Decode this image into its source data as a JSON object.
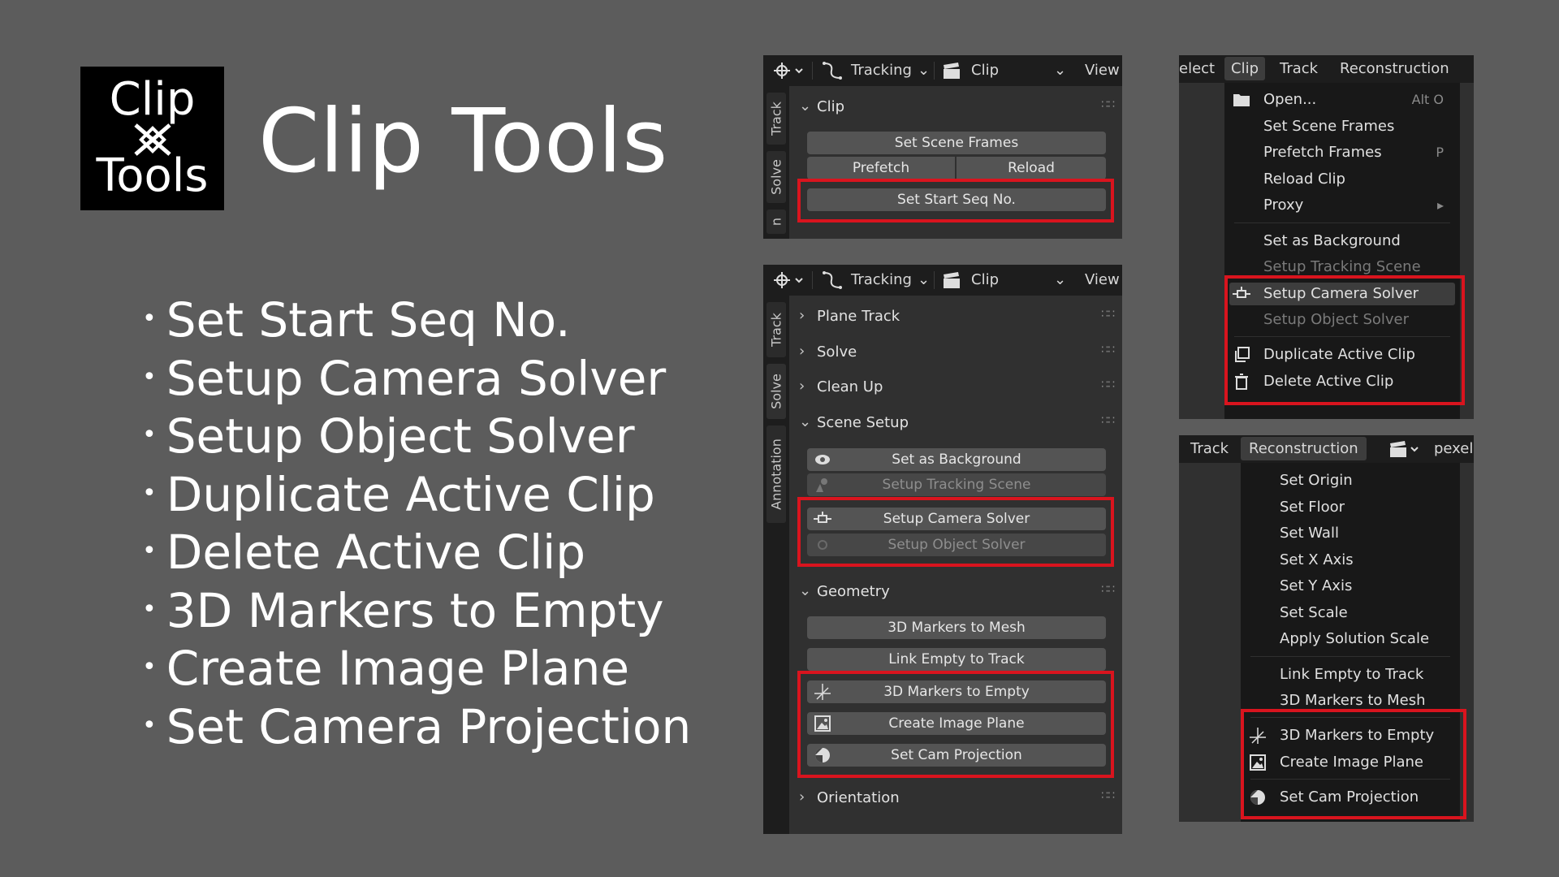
{
  "logo": {
    "line1": "Clip",
    "line2": "Tools"
  },
  "title": "Clip Tools",
  "features": [
    "Set Start Seq No.",
    "Setup Camera Solver",
    "Setup Object Solver",
    "Duplicate Active Clip",
    "Delete Active Clip",
    "3D Markers to Empty",
    "Create Image Plane",
    "Set Camera Projection"
  ],
  "header": {
    "mode": "Tracking",
    "clip": "Clip",
    "view": "View"
  },
  "panel1": {
    "tabs": [
      "Track",
      "Solve",
      "n"
    ],
    "section": "Clip",
    "buttons": [
      "Set Scene Frames",
      "Prefetch",
      "Reload",
      "Set Start Seq No."
    ]
  },
  "panel2": {
    "tabs": [
      "Track",
      "Solve",
      "Annotation"
    ],
    "sections": [
      "Plane Track",
      "Solve",
      "Clean Up",
      "Scene Setup",
      "Geometry",
      "Orientation"
    ],
    "scene_setup": [
      "Set as Background",
      "Setup Tracking Scene",
      "Setup Camera Solver",
      "Setup Object Solver"
    ],
    "geometry": [
      "3D Markers to Mesh",
      "Link Empty to Track",
      "3D Markers to Empty",
      "Create Image Plane",
      "Set Cam Projection"
    ]
  },
  "menu1": {
    "header": [
      "elect",
      "Clip",
      "Track",
      "Reconstruction"
    ],
    "items": [
      {
        "label": "Open...",
        "key": "Alt O"
      },
      {
        "label": "Set Scene Frames",
        "key": ""
      },
      {
        "label": "Prefetch Frames",
        "key": "P"
      },
      {
        "label": "Reload Clip",
        "key": ""
      },
      {
        "label": "Proxy",
        "key": "▸"
      },
      {
        "label": "Set as Background",
        "key": ""
      },
      {
        "label": "Setup Tracking Scene",
        "key": ""
      },
      {
        "label": "Setup Camera Solver",
        "key": ""
      },
      {
        "label": "Setup Object Solver",
        "key": ""
      },
      {
        "label": "Duplicate Active Clip",
        "key": ""
      },
      {
        "label": "Delete Active Clip",
        "key": ""
      }
    ]
  },
  "menu2": {
    "header": [
      "Track",
      "Reconstruction",
      "pexel"
    ],
    "items": [
      "Set Origin",
      "Set Floor",
      "Set Wall",
      "Set X Axis",
      "Set Y Axis",
      "Set Scale",
      "Apply Solution Scale",
      "Link Empty to Track",
      "3D Markers to Mesh",
      "3D Markers to Empty",
      "Create Image Plane",
      "Set Cam Projection"
    ]
  },
  "colors": {
    "background": "#5c5c5c",
    "highlight": "#d9141e",
    "panel": "#303030",
    "header": "#1d1d1d"
  }
}
